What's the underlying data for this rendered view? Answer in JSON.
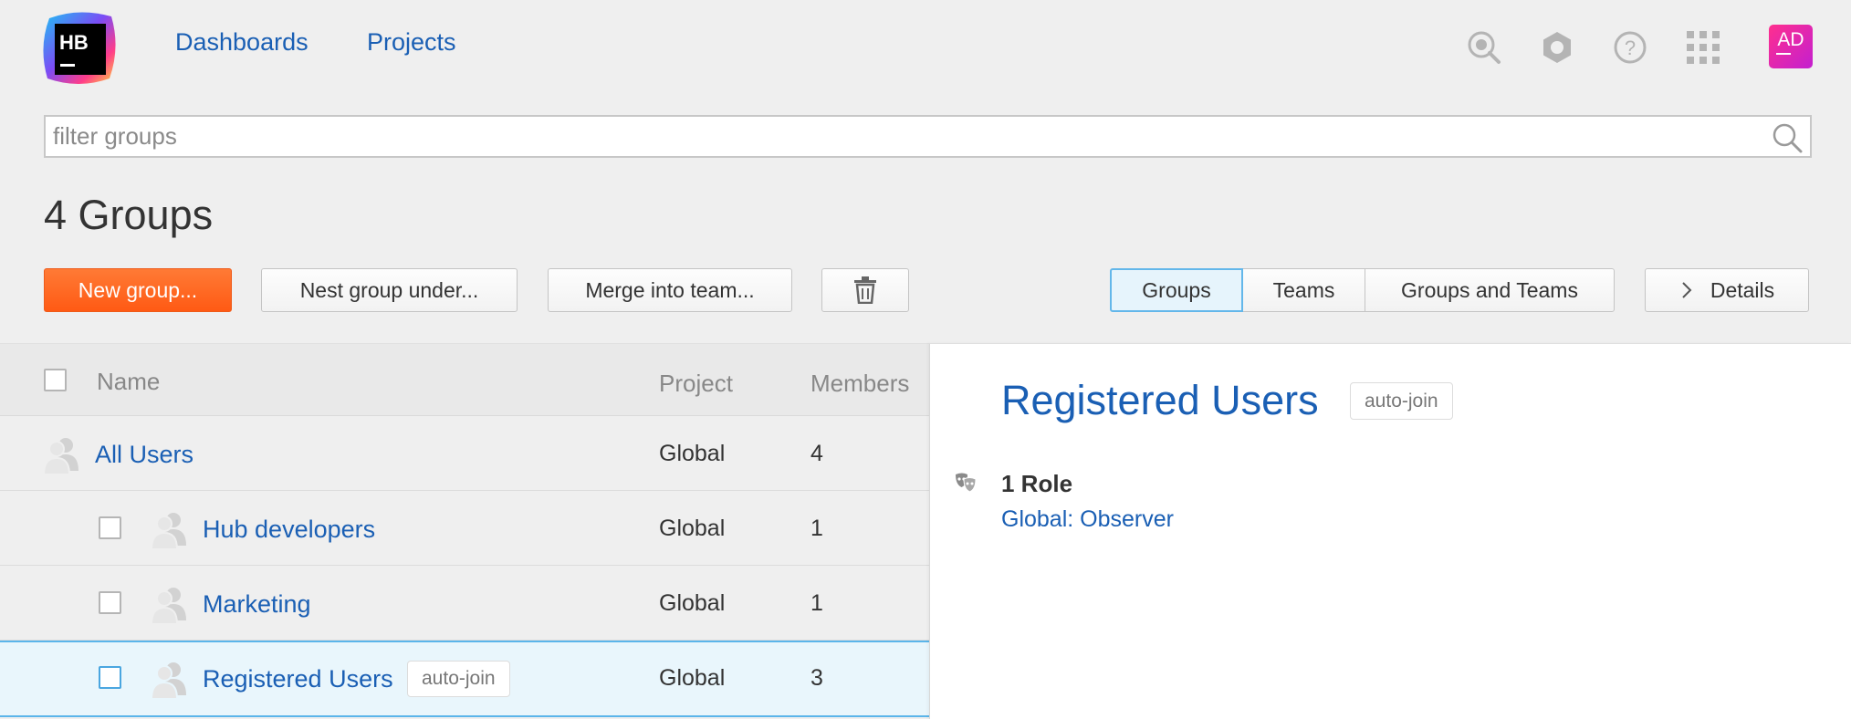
{
  "header": {
    "logo_text": "HB",
    "nav": [
      {
        "label": "Dashboards"
      },
      {
        "label": "Projects"
      }
    ],
    "icons": [
      "search-history-icon",
      "settings-icon",
      "help-icon",
      "apps-grid-icon"
    ],
    "user": {
      "initials": "AD"
    }
  },
  "search": {
    "placeholder": "filter groups",
    "value": ""
  },
  "page": {
    "title": "4 Groups"
  },
  "toolbar": {
    "new_group": "New group...",
    "nest_group": "Nest group under...",
    "merge_team": "Merge into team...",
    "delete_icon": "trash-icon",
    "view_tabs": [
      {
        "label": "Groups",
        "active": true
      },
      {
        "label": "Teams",
        "active": false
      },
      {
        "label": "Groups and Teams",
        "active": false
      }
    ],
    "details": "Details"
  },
  "table": {
    "columns": {
      "name": "Name",
      "project": "Project",
      "members": "Members"
    },
    "rows": [
      {
        "name": "All Users",
        "project": "Global",
        "members": "4",
        "tag": ""
      },
      {
        "name": "Hub developers",
        "project": "Global",
        "members": "1",
        "tag": ""
      },
      {
        "name": "Marketing",
        "project": "Global",
        "members": "1",
        "tag": ""
      },
      {
        "name": "Registered Users",
        "project": "Global",
        "members": "3",
        "tag": "auto-join"
      }
    ]
  },
  "details": {
    "title": "Registered Users",
    "tag": "auto-join",
    "roles_count": "1 Role",
    "role": "Global: Observer"
  },
  "colors": {
    "accent": "#ff5a14",
    "link": "#1a5fb4",
    "selected_row": "#e9f6fc",
    "selected_border": "#5bb5ea"
  }
}
